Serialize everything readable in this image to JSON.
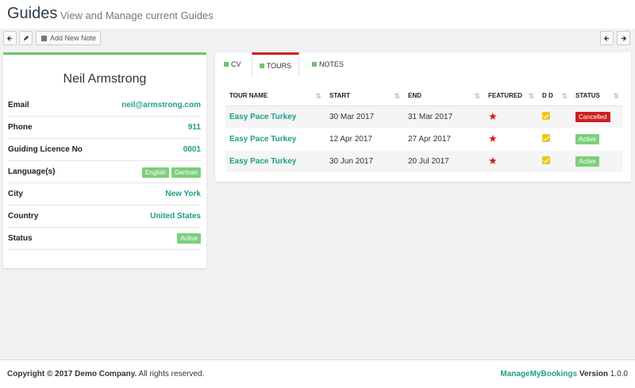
{
  "header": {
    "title": "Guides",
    "subtitle": "View and Manage current Guides"
  },
  "toolbar": {
    "add_note_label": "Add New Note"
  },
  "guide": {
    "name": "Neil Armstrong",
    "fields": [
      {
        "label": "Email",
        "value": "neil@armstrong.com"
      },
      {
        "label": "Phone",
        "value": "911"
      },
      {
        "label": "Guiding Licence No",
        "value": "0001"
      },
      {
        "label": "Language(s)",
        "tags": [
          "English",
          "German"
        ]
      },
      {
        "label": "City",
        "value": "New York"
      },
      {
        "label": "Country",
        "value": "United States"
      },
      {
        "label": "Status",
        "tag": "Active"
      }
    ]
  },
  "tabs": [
    {
      "label": "CV",
      "active": false
    },
    {
      "label": "TOURS",
      "active": true
    },
    {
      "label": "NOTES",
      "active": false
    }
  ],
  "table": {
    "headers": [
      "TOUR NAME",
      "START",
      "END",
      "FEATURED",
      "D D",
      "STATUS"
    ],
    "rows": [
      {
        "tour": "Easy Pace Turkey",
        "start": "30 Mar 2017",
        "end": "31 Mar 2017",
        "featured": true,
        "dd": true,
        "status": "Cancelled"
      },
      {
        "tour": "Easy Pace Turkey",
        "start": "12 Apr 2017",
        "end": "27 Apr 2017",
        "featured": true,
        "dd": true,
        "status": "Active"
      },
      {
        "tour": "Easy Pace Turkey",
        "start": "30 Jun 2017",
        "end": "20 Jul 2017",
        "featured": true,
        "dd": true,
        "status": "Active"
      }
    ]
  },
  "footer": {
    "copyright_bold": "Copyright © 2017 Demo Company.",
    "copyright_rest": " All rights reserved.",
    "brand": "ManageMyBookings",
    "version_label": "Version",
    "version": "1.0.0"
  },
  "colors": {
    "accent_green": "#6fc36f",
    "link_teal": "#1e9e87",
    "danger_red": "#cc1f1f",
    "check_yellow": "#f0c419"
  }
}
